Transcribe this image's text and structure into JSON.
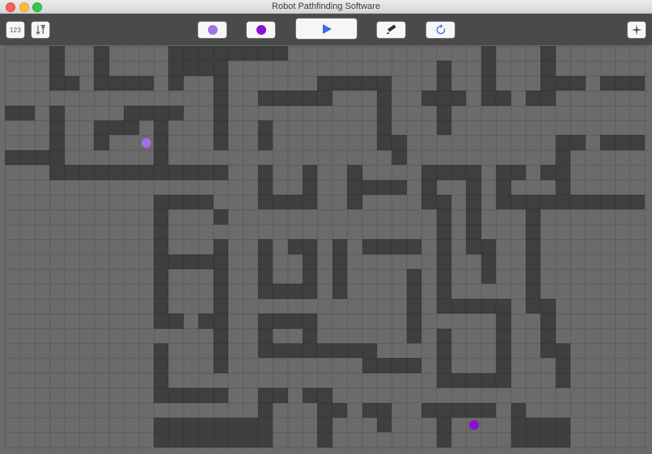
{
  "window": {
    "title": "Robot Pathfinding Software"
  },
  "toolbar": {
    "num_label": "123",
    "sort_icon": "sort-arrows-icon",
    "start_color": "#a371e6",
    "end_color": "#8b10d1",
    "run_icon": "play-icon",
    "run_color": "#3b6fd6",
    "draw_icon": "pencil-icon",
    "reset_icon": "refresh-icon",
    "reset_color": "#3b6fd6",
    "center_icon": "crosshair-icon"
  },
  "grid": {
    "cols": 43,
    "rows": 27,
    "wall_color": "#3f3f3f",
    "floor_color": "#6b6b6b",
    "start": {
      "col": 9,
      "row": 6,
      "color": "#a371e6"
    },
    "end": {
      "col": 31,
      "row": 25,
      "color": "#8b10d1"
    },
    "walls": [
      [
        3,
        0
      ],
      [
        6,
        0
      ],
      [
        11,
        0
      ],
      [
        12,
        0
      ],
      [
        13,
        0
      ],
      [
        14,
        0
      ],
      [
        15,
        0
      ],
      [
        16,
        0
      ],
      [
        17,
        0
      ],
      [
        18,
        0
      ],
      [
        32,
        0
      ],
      [
        36,
        0
      ],
      [
        3,
        1
      ],
      [
        6,
        1
      ],
      [
        11,
        1
      ],
      [
        12,
        1
      ],
      [
        13,
        1
      ],
      [
        14,
        1
      ],
      [
        29,
        1
      ],
      [
        32,
        1
      ],
      [
        36,
        1
      ],
      [
        3,
        2
      ],
      [
        4,
        2
      ],
      [
        6,
        2
      ],
      [
        7,
        2
      ],
      [
        8,
        2
      ],
      [
        9,
        2
      ],
      [
        11,
        2
      ],
      [
        14,
        2
      ],
      [
        21,
        2
      ],
      [
        22,
        2
      ],
      [
        23,
        2
      ],
      [
        24,
        2
      ],
      [
        25,
        2
      ],
      [
        29,
        2
      ],
      [
        32,
        2
      ],
      [
        36,
        2
      ],
      [
        37,
        2
      ],
      [
        38,
        2
      ],
      [
        40,
        2
      ],
      [
        41,
        2
      ],
      [
        42,
        2
      ],
      [
        14,
        3
      ],
      [
        17,
        3
      ],
      [
        18,
        3
      ],
      [
        19,
        3
      ],
      [
        20,
        3
      ],
      [
        21,
        3
      ],
      [
        25,
        3
      ],
      [
        28,
        3
      ],
      [
        29,
        3
      ],
      [
        30,
        3
      ],
      [
        32,
        3
      ],
      [
        33,
        3
      ],
      [
        35,
        3
      ],
      [
        36,
        3
      ],
      [
        0,
        4
      ],
      [
        1,
        4
      ],
      [
        3,
        4
      ],
      [
        8,
        4
      ],
      [
        9,
        4
      ],
      [
        10,
        4
      ],
      [
        11,
        4
      ],
      [
        14,
        4
      ],
      [
        25,
        4
      ],
      [
        29,
        4
      ],
      [
        3,
        5
      ],
      [
        6,
        5
      ],
      [
        7,
        5
      ],
      [
        8,
        5
      ],
      [
        10,
        5
      ],
      [
        14,
        5
      ],
      [
        17,
        5
      ],
      [
        25,
        5
      ],
      [
        29,
        5
      ],
      [
        3,
        6
      ],
      [
        6,
        6
      ],
      [
        10,
        6
      ],
      [
        14,
        6
      ],
      [
        17,
        6
      ],
      [
        25,
        6
      ],
      [
        26,
        6
      ],
      [
        37,
        6
      ],
      [
        38,
        6
      ],
      [
        40,
        6
      ],
      [
        41,
        6
      ],
      [
        42,
        6
      ],
      [
        0,
        7
      ],
      [
        1,
        7
      ],
      [
        2,
        7
      ],
      [
        3,
        7
      ],
      [
        10,
        7
      ],
      [
        26,
        7
      ],
      [
        37,
        7
      ],
      [
        3,
        8
      ],
      [
        4,
        8
      ],
      [
        5,
        8
      ],
      [
        6,
        8
      ],
      [
        7,
        8
      ],
      [
        8,
        8
      ],
      [
        9,
        8
      ],
      [
        10,
        8
      ],
      [
        11,
        8
      ],
      [
        12,
        8
      ],
      [
        13,
        8
      ],
      [
        14,
        8
      ],
      [
        17,
        8
      ],
      [
        20,
        8
      ],
      [
        23,
        8
      ],
      [
        28,
        8
      ],
      [
        29,
        8
      ],
      [
        30,
        8
      ],
      [
        31,
        8
      ],
      [
        33,
        8
      ],
      [
        34,
        8
      ],
      [
        36,
        8
      ],
      [
        37,
        8
      ],
      [
        17,
        9
      ],
      [
        20,
        9
      ],
      [
        23,
        9
      ],
      [
        24,
        9
      ],
      [
        25,
        9
      ],
      [
        26,
        9
      ],
      [
        28,
        9
      ],
      [
        31,
        9
      ],
      [
        33,
        9
      ],
      [
        37,
        9
      ],
      [
        10,
        10
      ],
      [
        11,
        10
      ],
      [
        12,
        10
      ],
      [
        13,
        10
      ],
      [
        17,
        10
      ],
      [
        18,
        10
      ],
      [
        19,
        10
      ],
      [
        20,
        10
      ],
      [
        23,
        10
      ],
      [
        28,
        10
      ],
      [
        29,
        10
      ],
      [
        31,
        10
      ],
      [
        33,
        10
      ],
      [
        34,
        10
      ],
      [
        35,
        10
      ],
      [
        36,
        10
      ],
      [
        37,
        10
      ],
      [
        38,
        10
      ],
      [
        39,
        10
      ],
      [
        40,
        10
      ],
      [
        41,
        10
      ],
      [
        42,
        10
      ],
      [
        10,
        11
      ],
      [
        14,
        11
      ],
      [
        29,
        11
      ],
      [
        31,
        11
      ],
      [
        35,
        11
      ],
      [
        10,
        12
      ],
      [
        29,
        12
      ],
      [
        31,
        12
      ],
      [
        35,
        12
      ],
      [
        10,
        13
      ],
      [
        14,
        13
      ],
      [
        17,
        13
      ],
      [
        19,
        13
      ],
      [
        20,
        13
      ],
      [
        22,
        13
      ],
      [
        24,
        13
      ],
      [
        25,
        13
      ],
      [
        26,
        13
      ],
      [
        27,
        13
      ],
      [
        29,
        13
      ],
      [
        31,
        13
      ],
      [
        32,
        13
      ],
      [
        35,
        13
      ],
      [
        10,
        14
      ],
      [
        11,
        14
      ],
      [
        12,
        14
      ],
      [
        13,
        14
      ],
      [
        14,
        14
      ],
      [
        17,
        14
      ],
      [
        20,
        14
      ],
      [
        22,
        14
      ],
      [
        29,
        14
      ],
      [
        32,
        14
      ],
      [
        35,
        14
      ],
      [
        10,
        15
      ],
      [
        14,
        15
      ],
      [
        17,
        15
      ],
      [
        20,
        15
      ],
      [
        22,
        15
      ],
      [
        27,
        15
      ],
      [
        29,
        15
      ],
      [
        32,
        15
      ],
      [
        35,
        15
      ],
      [
        10,
        16
      ],
      [
        14,
        16
      ],
      [
        17,
        16
      ],
      [
        18,
        16
      ],
      [
        19,
        16
      ],
      [
        20,
        16
      ],
      [
        22,
        16
      ],
      [
        27,
        16
      ],
      [
        29,
        16
      ],
      [
        35,
        16
      ],
      [
        10,
        17
      ],
      [
        14,
        17
      ],
      [
        27,
        17
      ],
      [
        29,
        17
      ],
      [
        30,
        17
      ],
      [
        31,
        17
      ],
      [
        32,
        17
      ],
      [
        33,
        17
      ],
      [
        35,
        17
      ],
      [
        36,
        17
      ],
      [
        10,
        18
      ],
      [
        11,
        18
      ],
      [
        13,
        18
      ],
      [
        14,
        18
      ],
      [
        17,
        18
      ],
      [
        18,
        18
      ],
      [
        19,
        18
      ],
      [
        20,
        18
      ],
      [
        27,
        18
      ],
      [
        33,
        18
      ],
      [
        36,
        18
      ],
      [
        14,
        19
      ],
      [
        17,
        19
      ],
      [
        20,
        19
      ],
      [
        27,
        19
      ],
      [
        29,
        19
      ],
      [
        33,
        19
      ],
      [
        36,
        19
      ],
      [
        10,
        20
      ],
      [
        14,
        20
      ],
      [
        17,
        20
      ],
      [
        18,
        20
      ],
      [
        19,
        20
      ],
      [
        20,
        20
      ],
      [
        21,
        20
      ],
      [
        22,
        20
      ],
      [
        23,
        20
      ],
      [
        24,
        20
      ],
      [
        29,
        20
      ],
      [
        33,
        20
      ],
      [
        36,
        20
      ],
      [
        37,
        20
      ],
      [
        10,
        21
      ],
      [
        14,
        21
      ],
      [
        24,
        21
      ],
      [
        25,
        21
      ],
      [
        26,
        21
      ],
      [
        27,
        21
      ],
      [
        29,
        21
      ],
      [
        33,
        21
      ],
      [
        37,
        21
      ],
      [
        10,
        22
      ],
      [
        29,
        22
      ],
      [
        30,
        22
      ],
      [
        31,
        22
      ],
      [
        32,
        22
      ],
      [
        33,
        22
      ],
      [
        37,
        22
      ],
      [
        10,
        23
      ],
      [
        11,
        23
      ],
      [
        12,
        23
      ],
      [
        13,
        23
      ],
      [
        14,
        23
      ],
      [
        17,
        23
      ],
      [
        18,
        23
      ],
      [
        20,
        23
      ],
      [
        21,
        23
      ],
      [
        17,
        24
      ],
      [
        21,
        24
      ],
      [
        22,
        24
      ],
      [
        24,
        24
      ],
      [
        25,
        24
      ],
      [
        28,
        24
      ],
      [
        29,
        24
      ],
      [
        30,
        24
      ],
      [
        31,
        24
      ],
      [
        32,
        24
      ],
      [
        34,
        24
      ],
      [
        10,
        25
      ],
      [
        11,
        25
      ],
      [
        12,
        25
      ],
      [
        13,
        25
      ],
      [
        14,
        25
      ],
      [
        15,
        25
      ],
      [
        16,
        25
      ],
      [
        17,
        25
      ],
      [
        21,
        25
      ],
      [
        25,
        25
      ],
      [
        29,
        25
      ],
      [
        34,
        25
      ],
      [
        35,
        25
      ],
      [
        36,
        25
      ],
      [
        37,
        25
      ],
      [
        10,
        26
      ],
      [
        11,
        26
      ],
      [
        12,
        26
      ],
      [
        13,
        26
      ],
      [
        14,
        26
      ],
      [
        15,
        26
      ],
      [
        16,
        26
      ],
      [
        17,
        26
      ],
      [
        21,
        26
      ],
      [
        29,
        26
      ],
      [
        34,
        26
      ],
      [
        35,
        26
      ],
      [
        36,
        26
      ],
      [
        37,
        26
      ]
    ]
  }
}
